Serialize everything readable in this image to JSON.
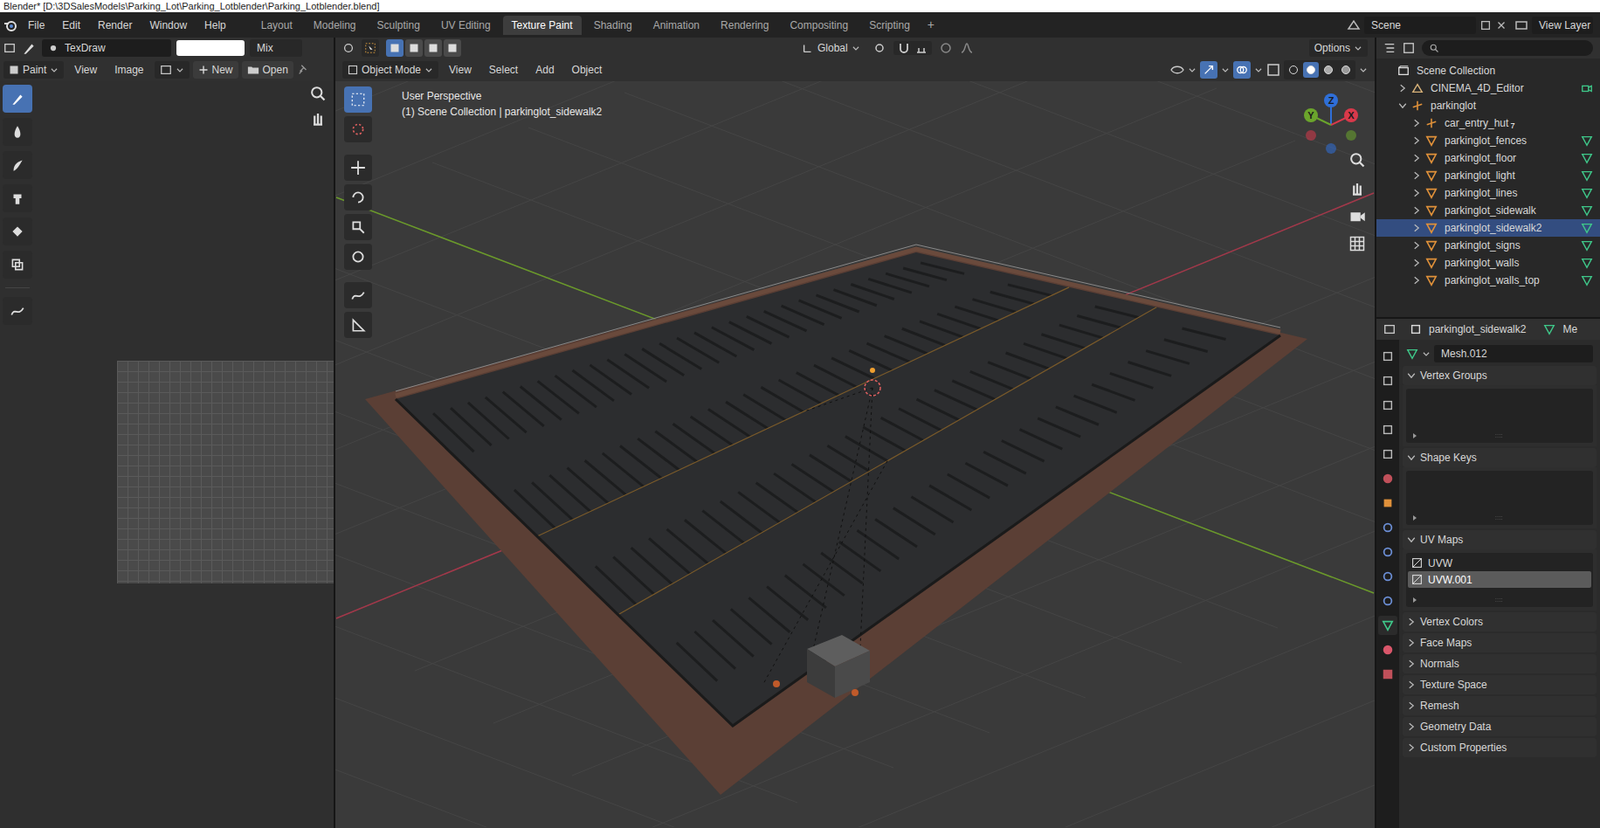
{
  "window": {
    "title": "Blender* [D:\\3DSalesModels\\Parking_Lot\\Parking_Lotblender\\Parking_Lotblender.blend]"
  },
  "menu": [
    "File",
    "Edit",
    "Render",
    "Window",
    "Help"
  ],
  "workspaces": [
    {
      "label": "Layout",
      "selected": false
    },
    {
      "label": "Modeling",
      "selected": false
    },
    {
      "label": "Sculpting",
      "selected": false
    },
    {
      "label": "UV Editing",
      "selected": false
    },
    {
      "label": "Texture Paint",
      "selected": true
    },
    {
      "label": "Shading",
      "selected": false
    },
    {
      "label": "Animation",
      "selected": false
    },
    {
      "label": "Rendering",
      "selected": false
    },
    {
      "label": "Compositing",
      "selected": false
    },
    {
      "label": "Scripting",
      "selected": false
    }
  ],
  "add_workspace": "+",
  "scene": "Scene",
  "view_layer": "View Layer",
  "image_editor": {
    "brush": "TexDraw",
    "color": "#ffffff",
    "blend": "Mix",
    "mode": "Paint",
    "menus": [
      "View",
      "Image"
    ],
    "new": "New",
    "open": "Open"
  },
  "viewport": {
    "orientation": "Global",
    "options": "Options",
    "mode": "Object Mode",
    "menus": [
      "View",
      "Select",
      "Add",
      "Object"
    ],
    "view_name": "User Perspective",
    "context": "(1) Scene Collection | parkinglot_sidewalk2",
    "gizmo": [
      {
        "label": "Z",
        "color": "#2f6fd8"
      },
      {
        "label": "X",
        "color": "#d9394b"
      },
      {
        "label": "Y",
        "color": "#6ba52c"
      }
    ]
  },
  "outliner": {
    "items": [
      {
        "name": "Scene Collection",
        "depth": 0,
        "kind": "collection",
        "expanded": true,
        "selected": false
      },
      {
        "name": "CINEMA_4D_Editor",
        "depth": 1,
        "kind": "camera",
        "expanded": false,
        "selected": false
      },
      {
        "name": "parkinglot",
        "depth": 1,
        "kind": "empty",
        "expanded": true,
        "selected": false
      },
      {
        "name": "car_entry_hut",
        "depth": 2,
        "kind": "empty",
        "expanded": false,
        "selected": false,
        "badge": "7"
      },
      {
        "name": "parkinglot_fences",
        "depth": 2,
        "kind": "mesh",
        "expanded": false,
        "selected": false
      },
      {
        "name": "parkinglot_floor",
        "depth": 2,
        "kind": "mesh",
        "expanded": false,
        "selected": false
      },
      {
        "name": "parkinglot_light",
        "depth": 2,
        "kind": "mesh",
        "expanded": false,
        "selected": false
      },
      {
        "name": "parkinglot_lines",
        "depth": 2,
        "kind": "mesh",
        "expanded": false,
        "selected": false
      },
      {
        "name": "parkinglot_sidewalk",
        "depth": 2,
        "kind": "mesh",
        "expanded": false,
        "selected": false
      },
      {
        "name": "parkinglot_sidewalk2",
        "depth": 2,
        "kind": "mesh",
        "expanded": false,
        "selected": true
      },
      {
        "name": "parkinglot_signs",
        "depth": 2,
        "kind": "mesh",
        "expanded": false,
        "selected": false
      },
      {
        "name": "parkinglot_walls",
        "depth": 2,
        "kind": "mesh",
        "expanded": false,
        "selected": false
      },
      {
        "name": "parkinglot_walls_top",
        "depth": 2,
        "kind": "mesh",
        "expanded": false,
        "selected": false
      }
    ]
  },
  "properties": {
    "object": "parkinglot_sidewalk2",
    "data_tab": "Me",
    "mesh": "Mesh.012",
    "panels": [
      {
        "title": "Vertex Groups",
        "expanded": true,
        "kind": "list",
        "items": []
      },
      {
        "title": "Shape Keys",
        "expanded": true,
        "kind": "list",
        "items": []
      },
      {
        "title": "UV Maps",
        "expanded": true,
        "kind": "list",
        "items": [
          {
            "name": "UVW",
            "selected": false
          },
          {
            "name": "UVW.001",
            "selected": true
          }
        ]
      },
      {
        "title": "Vertex Colors",
        "expanded": false,
        "kind": "panel"
      },
      {
        "title": "Face Maps",
        "expanded": false,
        "kind": "panel"
      },
      {
        "title": "Normals",
        "expanded": false,
        "kind": "panel"
      },
      {
        "title": "Texture Space",
        "expanded": false,
        "kind": "panel"
      },
      {
        "title": "Remesh",
        "expanded": false,
        "kind": "panel"
      },
      {
        "title": "Geometry Data",
        "expanded": false,
        "kind": "panel"
      },
      {
        "title": "Custom Properties",
        "expanded": false,
        "kind": "panel"
      }
    ]
  }
}
